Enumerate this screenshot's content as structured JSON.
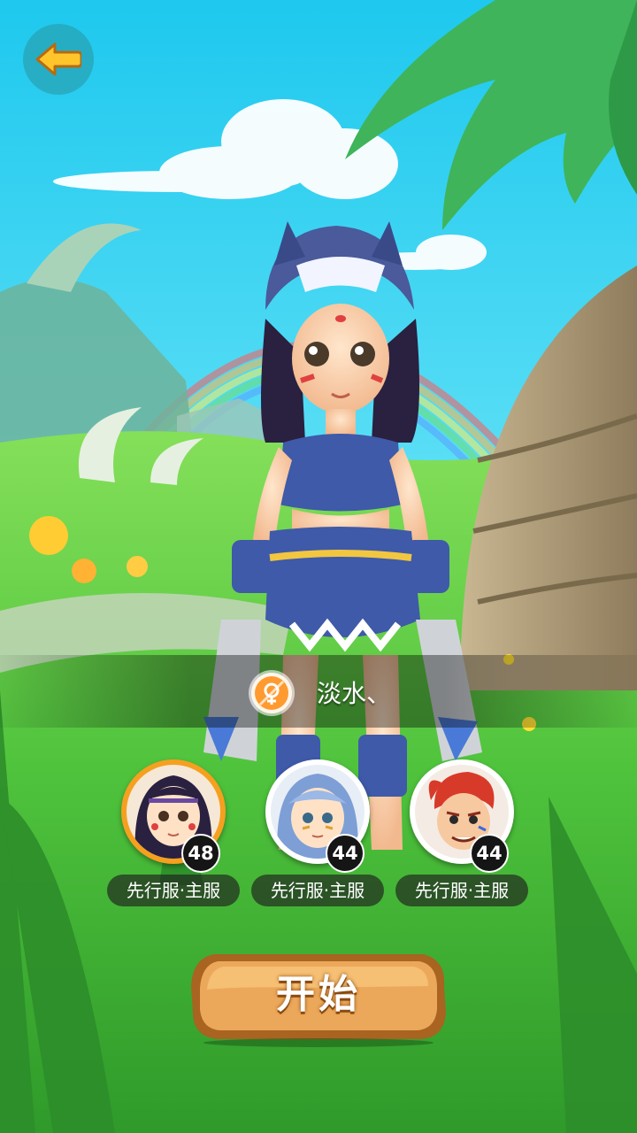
{
  "navigation": {
    "back_icon": "left-arrow-icon"
  },
  "selected_player": {
    "gender_icon": "female-gender-icon",
    "name": "淡水、"
  },
  "roles": [
    {
      "level": "48",
      "server": "先行服·主服",
      "selected": true
    },
    {
      "level": "44",
      "server": "先行服·主服",
      "selected": false
    },
    {
      "level": "44",
      "server": "先行服·主服",
      "selected": false
    }
  ],
  "start_button": {
    "label": "开始"
  },
  "colors": {
    "selected_ring": "#f6a020",
    "start_button": "#e8a050",
    "sky": "#3fd3f0"
  }
}
